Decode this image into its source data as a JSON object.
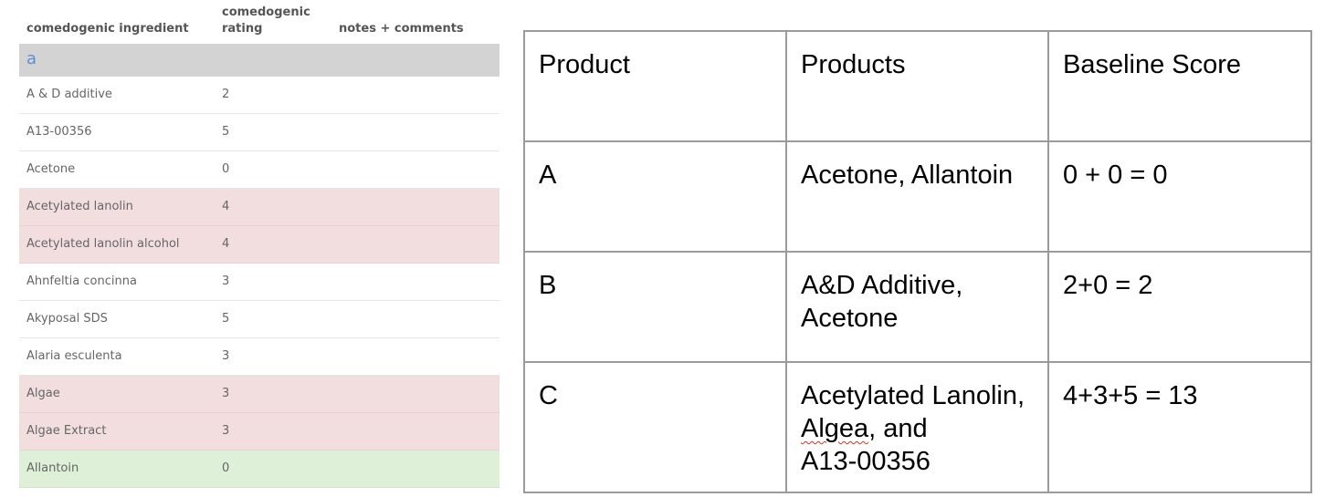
{
  "ingredient_list": {
    "headers": {
      "ingredient": "comedogenic ingredient",
      "rating": "comedogenic\nrating",
      "notes": "notes + comments"
    },
    "section_letter": "a",
    "rows": [
      {
        "name": "A & D additive",
        "rating": "2",
        "notes": "",
        "highlight": "none"
      },
      {
        "name": "A13-00356",
        "rating": "5",
        "notes": "",
        "highlight": "none"
      },
      {
        "name": "Acetone",
        "rating": "0",
        "notes": "",
        "highlight": "none"
      },
      {
        "name": "Acetylated lanolin",
        "rating": "4",
        "notes": "",
        "highlight": "red"
      },
      {
        "name": "Acetylated lanolin alcohol",
        "rating": "4",
        "notes": "",
        "highlight": "red"
      },
      {
        "name": "Ahnfeltia concinna",
        "rating": "3",
        "notes": "",
        "highlight": "none"
      },
      {
        "name": "Akyposal SDS",
        "rating": "5",
        "notes": "",
        "highlight": "none"
      },
      {
        "name": "Alaria esculenta",
        "rating": "3",
        "notes": "",
        "highlight": "none"
      },
      {
        "name": "Algae",
        "rating": "3",
        "notes": "",
        "highlight": "red"
      },
      {
        "name": "Algae Extract",
        "rating": "3",
        "notes": "",
        "highlight": "red"
      },
      {
        "name": "Allantoin",
        "rating": "0",
        "notes": "",
        "highlight": "green"
      }
    ],
    "colors": {
      "section_bg": "#d3d3d3",
      "section_letter": "#5b8fd6",
      "red_row": "#f2dedf",
      "green_row": "#dff0d8"
    }
  },
  "score_table": {
    "headers": [
      "Product",
      "Products",
      "Baseline Score"
    ],
    "rows": [
      {
        "product": "A",
        "products": "Acetone, Allantoin",
        "score": "0 + 0 = 0"
      },
      {
        "product": "B",
        "products_line1": "A&D Additive,",
        "products_line2": "Acetone",
        "score": "2+0 = 2"
      },
      {
        "product": "C",
        "products_line1": "Acetylated Lanolin,",
        "products_line2_word": "Algea",
        "products_line2_rest": ", and",
        "products_line3": "A13-00356",
        "score": "4+3+5 = 13"
      }
    ]
  }
}
